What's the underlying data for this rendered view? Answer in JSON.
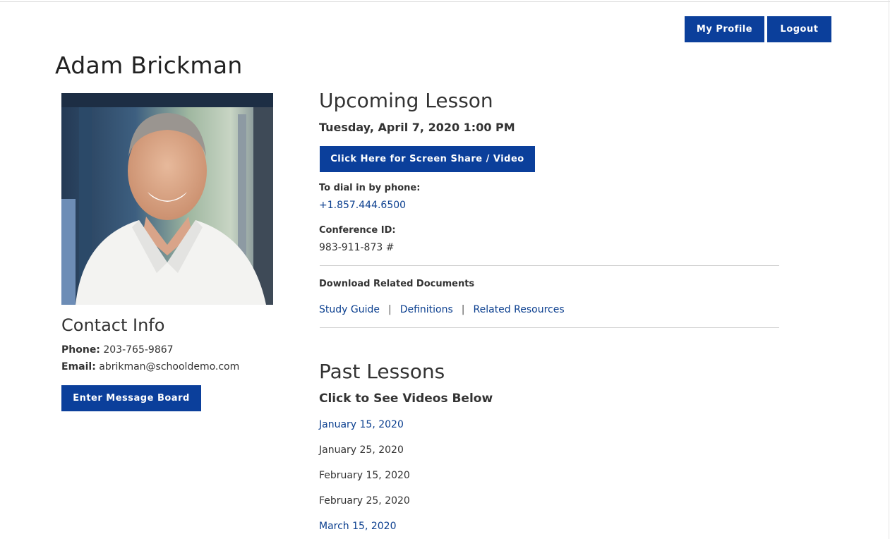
{
  "header": {
    "my_profile_label": "My Profile",
    "logout_label": "Logout"
  },
  "teacher": {
    "name": "Adam Brickman"
  },
  "contact": {
    "title": "Contact Info",
    "phone_label": "Phone:",
    "phone": "203-765-9867",
    "email_label": "Email:",
    "email": "abrikman@schooldemo.com",
    "message_board_label": "Enter Message Board"
  },
  "upcoming": {
    "title": "Upcoming Lesson",
    "date": "Tuesday, April 7, 2020 1:00 PM",
    "screen_share_label": "Click Here for Screen Share / Video",
    "dial_label": "To dial in by phone:",
    "dial_number": "+1.857.444.6500",
    "conference_label": "Conference ID:",
    "conference_id": "983-911-873 #",
    "documents_label": "Download Related Documents",
    "documents": [
      {
        "label": "Study Guide"
      },
      {
        "label": "Definitions"
      },
      {
        "label": "Related Resources"
      }
    ],
    "separator": "|"
  },
  "past": {
    "title": "Past Lessons",
    "subtitle": "Click to See Videos Below",
    "lessons": [
      {
        "label": "January 15, 2020",
        "linked": true
      },
      {
        "label": "January 25, 2020",
        "linked": false
      },
      {
        "label": "February 15, 2020",
        "linked": false
      },
      {
        "label": "February 25, 2020",
        "linked": false
      },
      {
        "label": "March 15, 2020",
        "linked": true
      }
    ]
  },
  "colors": {
    "button": "#0b3f9b",
    "link": "#0b3f8f"
  }
}
